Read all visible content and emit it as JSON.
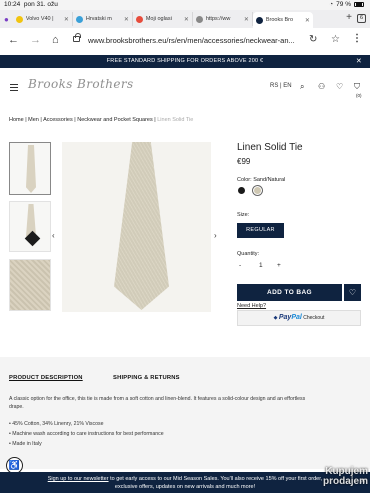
{
  "status_bar": {
    "time": "10:24",
    "date": "pon 31. ožu",
    "battery": "79 %"
  },
  "tabs": [
    {
      "label": "Volvo V40 |",
      "color": "#f1c40f"
    },
    {
      "label": "Hrvatski m",
      "color": "#3aa0d8"
    },
    {
      "label": "Moji oglasi",
      "color": "#e74c3c"
    },
    {
      "label": "https://ww",
      "color": "#888888"
    },
    {
      "label": "Brooks Bro",
      "color": "#0f2340"
    }
  ],
  "tab_count": "6",
  "address_bar": {
    "url": "www.brooksbrothers.eu/rs/en/men/accessories/neckwear-an..."
  },
  "promo": {
    "text": "FREE STANDARD SHIPPING FOR ORDERS ABOVE 200 €"
  },
  "header": {
    "logo": "Brooks Brothers",
    "language": "RS | EN",
    "bag_count": "(0)"
  },
  "breadcrumb": {
    "home": "Home",
    "men": "Men",
    "accessories": "Accessories",
    "neckwear": "Neckwear and Pocket Squares",
    "current": "Linen Solid Tie"
  },
  "product": {
    "title": "Linen Solid Tie",
    "price": "€99",
    "color_label": "Color: Sand/Natural",
    "size_label": "Size:",
    "size_value": "REGULAR",
    "quantity_label": "Quantity:",
    "quantity": "1",
    "minus": "-",
    "plus": "+",
    "add_to_bag": "ADD TO BAG",
    "need_help": "Need Help?",
    "paypal_pay": "Pay",
    "paypal_pal": "Pal",
    "paypal_checkout": "Checkout"
  },
  "details": {
    "tab_description": "PRODUCT DESCRIPTION",
    "tab_shipping": "SHIPPING & RETURNS",
    "description": "A classic option for the office, this tie is made from a soft cotton and linen-blend. It features a solid-colour design and an effortless drape.",
    "bullets": [
      "• 45% Cotton, 34% Linenry, 21% Viscose",
      "• Machine wash according to care instructions for best performance",
      "• Made in Italy"
    ]
  },
  "newsletter": {
    "link": "Sign up to our newsletter",
    "line1_rest": " to get early access to our Mid Season Sales. You'll also receive 15% off your first order,",
    "line2": "exclusive offers, updates on new arrivals and much more!"
  },
  "watermark": {
    "line1": "Kupujem",
    "line2": "prodajem"
  }
}
